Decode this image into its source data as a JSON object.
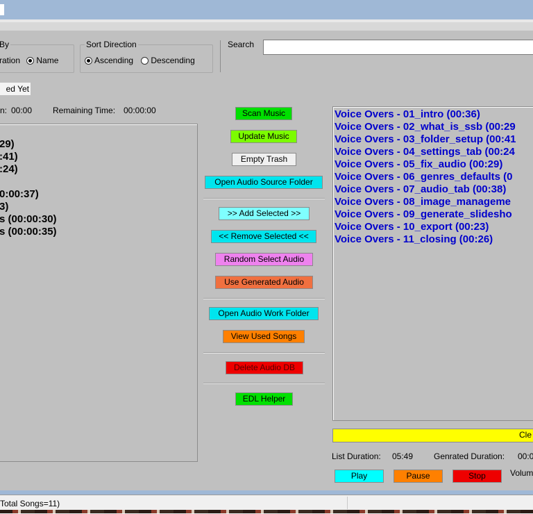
{
  "sort_by": {
    "legend": "By",
    "option_partial": "ration",
    "option_name": "Name",
    "selected": "Name"
  },
  "sort_direction": {
    "legend": "Sort Direction",
    "ascending": "Ascending",
    "descending": "Descending",
    "selected": "Ascending"
  },
  "search": {
    "label": "Search",
    "value": ""
  },
  "status_tag": "ed Yet",
  "left_info": {
    "duration_suffix": "n:",
    "duration_value": "00:00",
    "remaining_label": "Remaining Time:",
    "remaining_value": "00:00:00"
  },
  "left_list": [
    "29)",
    ":41)",
    ":24)",
    "",
    "0:00:37)",
    "3)",
    "s (00:00:30)",
    "s (00:00:35)"
  ],
  "buttons": {
    "scan_music": "Scan Music",
    "update_music": "Update Music",
    "empty_trash": "Empty Trash",
    "open_audio_source": "Open Audio Source Folder",
    "add_selected": ">> Add Selected >>",
    "remove_selected": "<< Remove Selected <<",
    "random_select": "Random Select Audio",
    "use_generated": "Use Generated Audio",
    "open_audio_work": "Open Audio Work Folder",
    "view_used_songs": "View Used Songs",
    "delete_audio_db": "Delete Audio DB",
    "edl_helper": "EDL Helper",
    "clear": "Cle",
    "play": "Play",
    "pause": "Pause",
    "stop": "Stop"
  },
  "button_colors": {
    "scan_music": "#00e000",
    "update_music": "#7cfc00",
    "empty_trash": "#f0f0f0",
    "open_audio_source": "#00e5ee",
    "add_selected": "#7fffff",
    "remove_selected": "#00e5ee",
    "random_select": "#ee82ee",
    "use_generated": "#f07040",
    "open_audio_work": "#00e5ee",
    "view_used_songs": "#ff8000",
    "delete_audio_db": "#ee0000",
    "edl_helper": "#00e000",
    "clear": "#ffff00",
    "play": "#00ffff",
    "pause": "#ff8000",
    "stop": "#ee0000"
  },
  "right_list": [
    "Voice Overs - 01_intro (00:36)",
    "Voice Overs - 02_what_is_ssb (00:29",
    "Voice Overs - 03_folder_setup (00:41",
    "Voice Overs - 04_settings_tab (00:24",
    "Voice Overs - 05_fix_audio (00:29)",
    "Voice Overs - 06_genres_defaults (0",
    "Voice Overs - 07_audio_tab (00:38)",
    "Voice Overs - 08_image_manageme",
    "Voice Overs - 09_generate_slidesho",
    "Voice Overs - 10_export (00:23)",
    "Voice Overs - 11_closing (00:26)"
  ],
  "right_info": {
    "list_duration_label": "List Duration:",
    "list_duration_value": "05:49",
    "generated_label": "Genrated Duration:",
    "generated_value": "00:0",
    "volume_label": "Volum"
  },
  "status_bar": "Total Songs=11)"
}
